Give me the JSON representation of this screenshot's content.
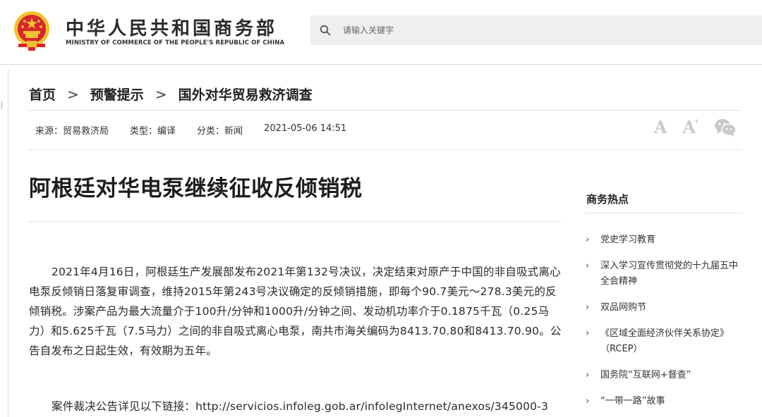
{
  "header": {
    "brand_cn": "中华人民共和国商务部",
    "brand_en": "MINISTRY OF COMMERCE OF THE PEOPLE'S REPUBLIC OF CHINA",
    "search_placeholder": "请输入关键字"
  },
  "breadcrumb": {
    "items": [
      "首页",
      "预警提示",
      "国外对华贸易救济调查"
    ],
    "separator": ">"
  },
  "meta": {
    "source": "来源：贸易救济局",
    "type": "类型：编译",
    "category": "分类：新闻",
    "datetime": "2021-05-06 14:51"
  },
  "tools": {
    "font_large": "A",
    "font_small": "A",
    "font_small_sup": "+",
    "icon_color": "#c9c9c9"
  },
  "article": {
    "title": "阿根廷对华电泵继续征收反倾销税",
    "paragraph1": "2021年4月16日，阿根廷生产发展部发布2021年第132号决议，决定结束对原产于中国的非自吸式离心电泵反倾销日落复审调查，维持2015年第243号决议确定的反倾销措施，即每个90.7美元～278.3美元的反倾销税。涉案产品为最大流量介于100升/分钟和1000升/分钟之间、发动机功率介于0.1875千瓦（0.25马力）和5.625千瓦（7.5马力）之间的非自吸式离心电泵，南共市海关编码为8413.70.80和8413.70.90。公告自发布之日起生效，有效期为五年。",
    "paragraph2": "案件裁决公告详见以下链接：http://servicios.infoleg.gob.ar/infolegInternet/anexos/345000-3"
  },
  "sidebar": {
    "title": "商务热点",
    "items": [
      "党史学习教育",
      "深入学习宣传贯彻党的十九届五中全会精神",
      "双品网购节",
      "《区域全面经济伙伴关系协定》（RCEP）",
      "国务院“互联网+督查”",
      "“一带一路”故事"
    ]
  },
  "colors": {
    "emblem_red": "#d8262b",
    "emblem_gold": "#f2c230",
    "search_bg": "#efefef"
  }
}
